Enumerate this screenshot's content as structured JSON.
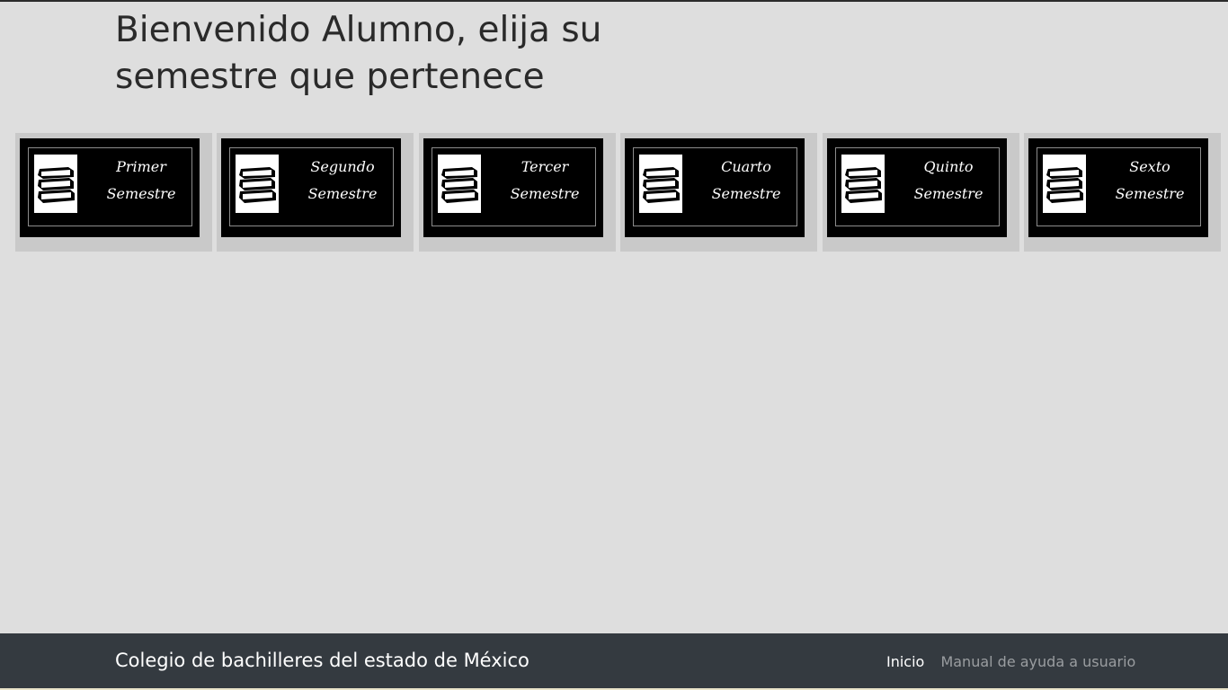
{
  "page": {
    "heading": "Bienvenido Alumno, elija su semestre que pertenece"
  },
  "semesters": [
    {
      "line1": "Primer",
      "line2": "Semestre",
      "icon": "books-icon"
    },
    {
      "line1": "Segundo",
      "line2": "Semestre",
      "icon": "books-icon"
    },
    {
      "line1": "Tercer",
      "line2": "Semestre",
      "icon": "books-icon"
    },
    {
      "line1": "Cuarto",
      "line2": "Semestre",
      "icon": "books-icon"
    },
    {
      "line1": "Quinto",
      "line2": "Semestre",
      "icon": "books-icon"
    },
    {
      "line1": "Sexto",
      "line2": "Semestre",
      "icon": "books-icon"
    }
  ],
  "footer": {
    "brand": "Colegio de bachilleres del estado de México",
    "nav": [
      {
        "label": "Inicio",
        "active": true
      },
      {
        "label": "Manual de ayuda a usuario",
        "active": false
      }
    ]
  },
  "colors": {
    "background": "#dedede",
    "footer": "#343a40",
    "card_face": "#000000",
    "card_shadow": "#c9c9c9"
  }
}
